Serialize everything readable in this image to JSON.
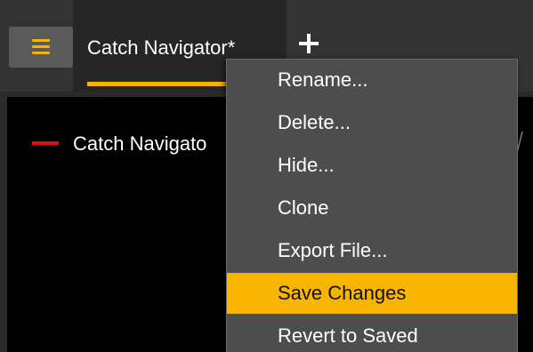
{
  "app": {
    "accent_color": "#f7b400",
    "tabs": [
      {
        "label": "Catch Navigator*",
        "active": true
      }
    ],
    "add_tab_icon": "plus-icon",
    "menu_icon": "hamburger-icon"
  },
  "panel": {
    "legend": [
      {
        "label": "Catch Navigato",
        "color": "#e01010"
      }
    ]
  },
  "dropdown": {
    "items": [
      {
        "label": "Rename...",
        "highlighted": false
      },
      {
        "label": "Delete...",
        "highlighted": false
      },
      {
        "label": "Hide...",
        "highlighted": false
      },
      {
        "label": "Clone",
        "highlighted": false
      },
      {
        "label": "Export File...",
        "highlighted": false
      },
      {
        "label": "Save Changes",
        "highlighted": true
      },
      {
        "label": "Revert to Saved",
        "highlighted": false
      }
    ]
  }
}
